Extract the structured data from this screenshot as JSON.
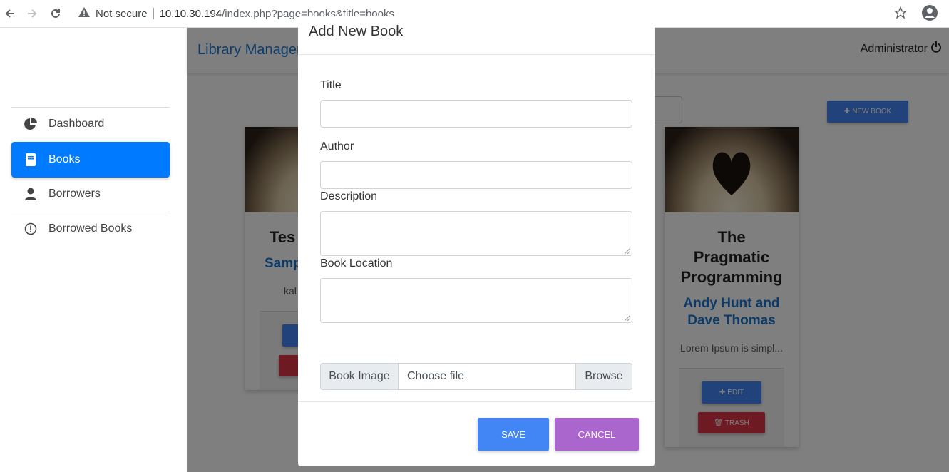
{
  "browser": {
    "security_label": "Not secure",
    "url_host": "10.10.30.194",
    "url_path": "/index.php?page=books&title=books",
    "icons": [
      "back-icon",
      "forward-icon",
      "reload-icon",
      "warning-icon",
      "star-icon",
      "account-icon"
    ]
  },
  "sidebar": {
    "items": [
      {
        "label": "Dashboard",
        "icon": "pie-chart-icon"
      },
      {
        "label": "Books",
        "icon": "book-icon",
        "active": true
      },
      {
        "label": "Borrowers",
        "icon": "user-icon"
      },
      {
        "label": "Borrowed Books",
        "icon": "exclamation-circle-icon"
      }
    ]
  },
  "header": {
    "brand": "Library Manager",
    "user": "Administrator"
  },
  "toolbar": {
    "new_book_label": "NEW BOOK"
  },
  "cards": [
    {
      "title": "Tes",
      "author": "Samp",
      "description": "kal"
    },
    {
      "title": "The Pragmatic Programming",
      "title_lines": [
        "The",
        "Pragmatic",
        "Programming"
      ],
      "author": "Andy Hunt and Dave Thomas",
      "author_lines": [
        "Andy Hunt and",
        "Dave Thomas"
      ],
      "description": "Lorem Ipsum is simpl...",
      "edit_label": "EDIT",
      "trash_label": "TRASH"
    }
  ],
  "modal": {
    "title": "Add New Book",
    "fields": {
      "title_label": "Title",
      "title_value": "",
      "author_label": "Author",
      "author_value": "",
      "description_label": "Description",
      "description_value": "",
      "location_label": "Book Location",
      "location_value": ""
    },
    "file": {
      "prefix": "Book Image",
      "placeholder": "Choose file",
      "browse": "Browse"
    },
    "save_label": "SAVE",
    "cancel_label": "CANCEL"
  },
  "colors": {
    "primary": "#4285f4",
    "sidebar_active": "#007bff",
    "brand": "#1976d2",
    "danger": "#dc3545",
    "cancel": "#aa66cc"
  }
}
